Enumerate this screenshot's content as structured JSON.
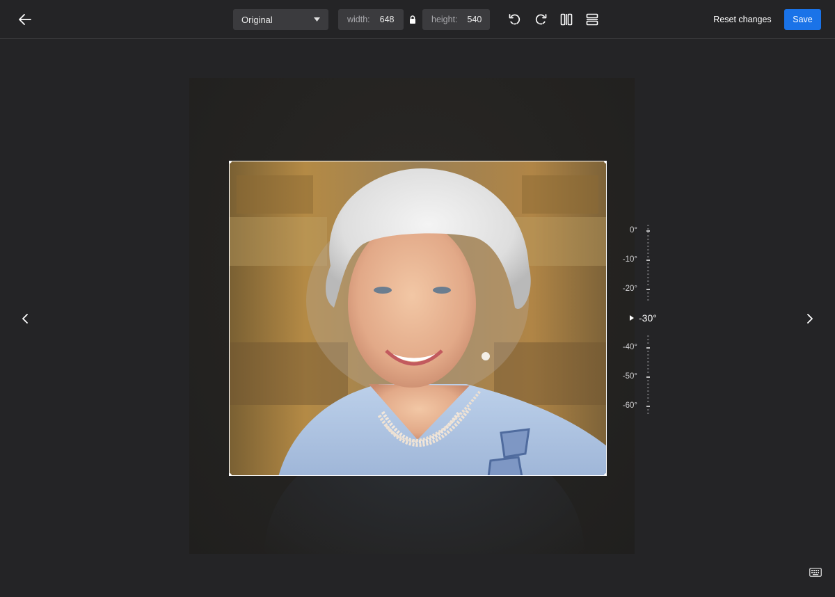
{
  "toolbar": {
    "aspect_select": {
      "value": "Original"
    },
    "width": {
      "label": "width:",
      "value": "648"
    },
    "height": {
      "label": "height:",
      "value": "540"
    },
    "reset_label": "Reset changes",
    "save_label": "Save",
    "icons": [
      "back-arrow-icon",
      "lock-icon",
      "rotate-left-icon",
      "rotate-right-icon",
      "flip-horizontal-icon",
      "flip-vertical-icon"
    ]
  },
  "rotation_dial": {
    "ticks": [
      "0°",
      "-10°",
      "-20°",
      "-40°",
      "-50°",
      "-60°"
    ],
    "current": "-30°"
  },
  "navigation": {
    "prev_icon": "chevron-left-icon",
    "next_icon": "chevron-right-icon"
  },
  "footer": {
    "keyboard_icon": "keyboard-icon"
  },
  "colors": {
    "accent": "#1a73e8",
    "background": "#242426",
    "control_bg": "#3b3b3e"
  }
}
